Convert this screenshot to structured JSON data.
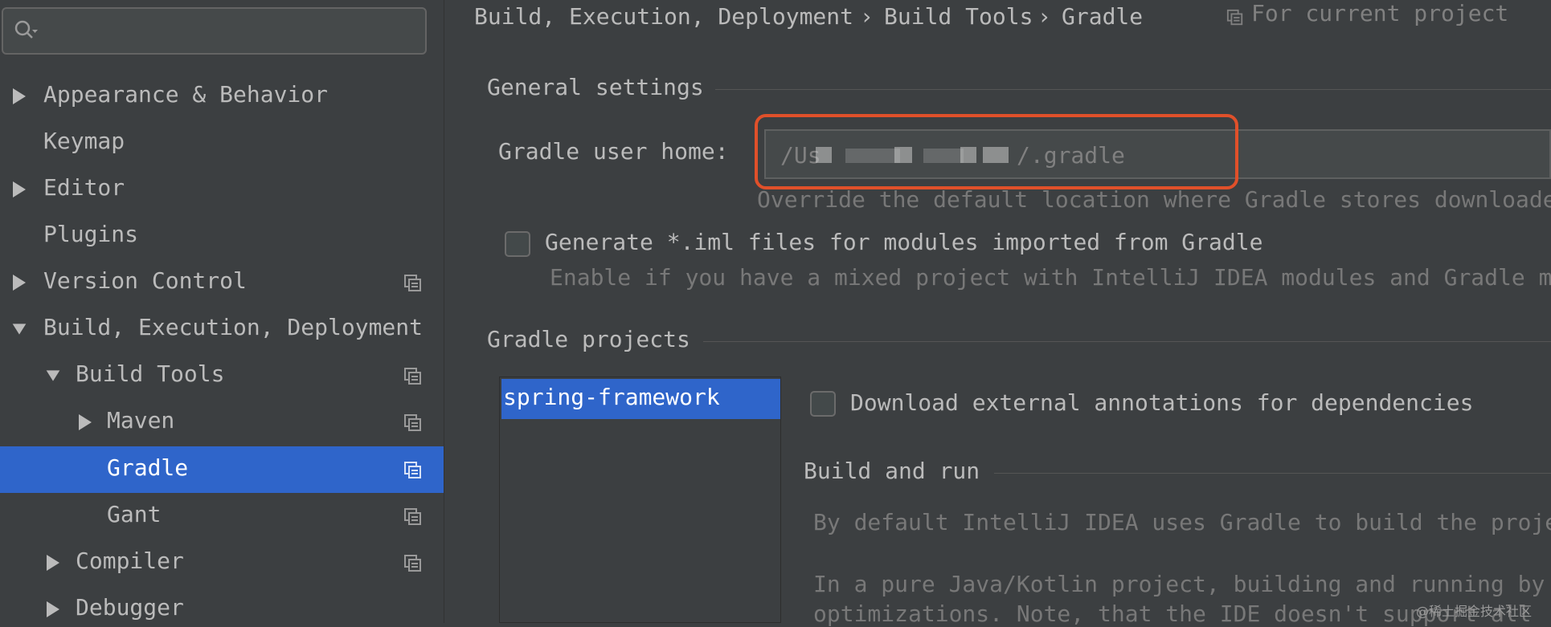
{
  "sidebar": {
    "search": {
      "value": "",
      "placeholder": ""
    },
    "items": [
      {
        "label": "Appearance & Behavior",
        "arrow": "right",
        "shared": false
      },
      {
        "label": "Keymap",
        "arrow": "none",
        "shared": false
      },
      {
        "label": "Editor",
        "arrow": "right",
        "shared": false
      },
      {
        "label": "Plugins",
        "arrow": "none",
        "shared": false
      },
      {
        "label": "Version Control",
        "arrow": "right",
        "shared": true
      },
      {
        "label": "Build, Execution, Deployment",
        "arrow": "down",
        "shared": false
      },
      {
        "label": "Build Tools",
        "arrow": "down",
        "shared": true
      },
      {
        "label": "Maven",
        "arrow": "right",
        "shared": true
      },
      {
        "label": "Gradle",
        "arrow": "none",
        "shared": true,
        "selected": true
      },
      {
        "label": "Gant",
        "arrow": "none",
        "shared": true
      },
      {
        "label": "Compiler",
        "arrow": "right",
        "shared": true
      },
      {
        "label": "Debugger",
        "arrow": "right",
        "shared": false
      }
    ]
  },
  "breadcrumb": {
    "items": [
      "Build, Execution, Deployment",
      "Build Tools",
      "Gradle"
    ],
    "separator": "›",
    "scope_label": "For current project"
  },
  "general_settings": {
    "title": "General settings",
    "user_home_label": "Gradle user home:",
    "user_home_value_prefix": "/Us",
    "user_home_value_suffix": "/.gradle",
    "user_home_hint": "Override the default location where Gradle stores downloade",
    "generate_iml": {
      "checked": false,
      "label": "Generate *.iml files for modules imported from Gradle",
      "hint": "Enable if you have a mixed project with IntelliJ IDEA modules and Gradle mo"
    }
  },
  "gradle_projects": {
    "title": "Gradle projects",
    "projects": [
      "spring-framework"
    ],
    "download_annotations": {
      "checked": false,
      "label": "Download external annotations for dependencies"
    },
    "build_and_run": {
      "title": "Build and run",
      "text1": "By default IntelliJ IDEA uses Gradle to build the proje",
      "text2": "In a pure Java/Kotlin project, building and running by",
      "text3": "optimizations. Note, that the IDE doesn't support all"
    }
  },
  "watermark": "@稀土掘金技术社区",
  "colors": {
    "background": "#3c3f41",
    "selection": "#2f65ca",
    "highlight": "#e0502a"
  }
}
